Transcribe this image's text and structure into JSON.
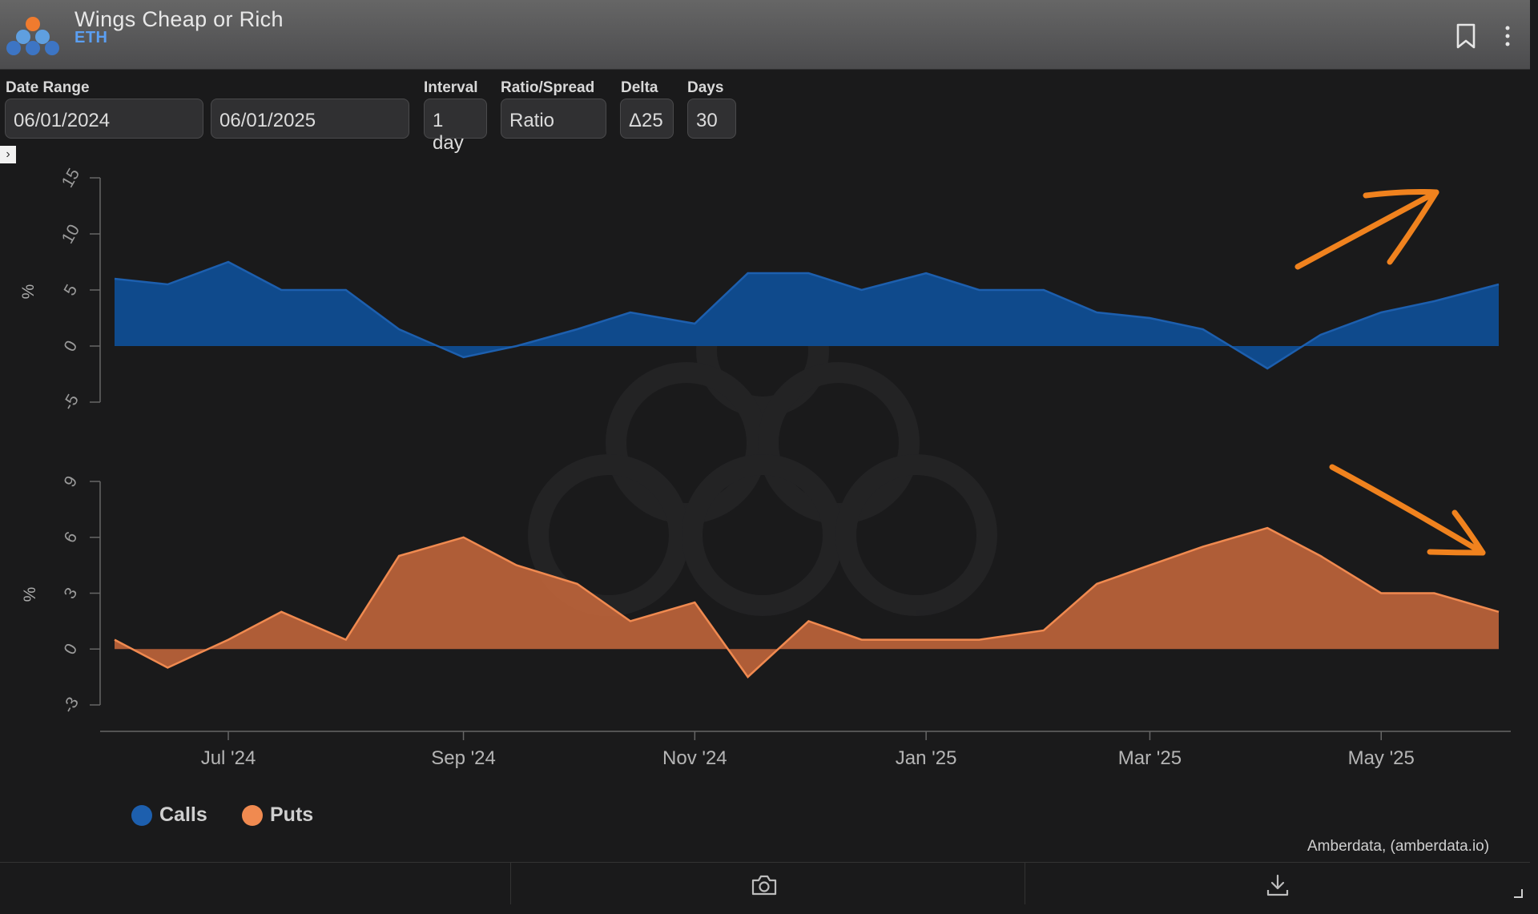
{
  "header": {
    "title": "Wings Cheap or Rich",
    "subtitle": "ETH"
  },
  "controls": {
    "date_range_label": "Date Range",
    "date_start": "06/01/2024",
    "date_end": "06/01/2025",
    "interval_label": "Interval",
    "interval_value": "1 day",
    "ratio_spread_label": "Ratio/Spread",
    "ratio_spread_value": "Ratio",
    "delta_label": "Delta",
    "delta_value": "Δ25",
    "days_label": "Days",
    "days_value": "30",
    "expand_icon": "chevron-right-icon"
  },
  "colors": {
    "calls": "#0f4a8c",
    "calls_line": "#1d5fae",
    "puts": "#c0653b",
    "puts_line": "#f08a50",
    "arrow": "#f0821e",
    "header_subtitle": "#5b9ff2"
  },
  "chart_data": {
    "type": "area",
    "x_range": [
      "2024-06-01",
      "2025-06-01"
    ],
    "x_tick_labels": [
      "Jul '24",
      "Sep '24",
      "Nov '24",
      "Jan '25",
      "Mar '25",
      "May '25"
    ],
    "panels": [
      {
        "series_name": "Calls",
        "ylabel": "%",
        "ylim": [
          -5,
          15
        ],
        "y_ticks": [
          "15",
          "10",
          "5",
          "0",
          "-5"
        ],
        "x": [
          "2024-06-01",
          "2024-06-15",
          "2024-07-01",
          "2024-07-15",
          "2024-08-01",
          "2024-08-15",
          "2024-09-01",
          "2024-09-15",
          "2024-10-01",
          "2024-10-15",
          "2024-11-01",
          "2024-11-15",
          "2024-12-01",
          "2024-12-15",
          "2025-01-01",
          "2025-01-15",
          "2025-02-01",
          "2025-02-15",
          "2025-03-01",
          "2025-03-15",
          "2025-04-01",
          "2025-04-15",
          "2025-05-01",
          "2025-05-15",
          "2025-06-01"
        ],
        "values": [
          6,
          5.5,
          7.5,
          5,
          5,
          1.5,
          -1,
          0,
          1.5,
          3,
          2,
          6.5,
          6.5,
          5,
          6.5,
          5,
          5,
          3,
          2.5,
          1.5,
          -2,
          1,
          3,
          4,
          5.5
        ]
      },
      {
        "series_name": "Puts",
        "ylabel": "%",
        "ylim": [
          -3,
          9
        ],
        "y_ticks": [
          "9",
          "6",
          "3",
          "0",
          "-3"
        ],
        "x": [
          "2024-06-01",
          "2024-06-15",
          "2024-07-01",
          "2024-07-15",
          "2024-08-01",
          "2024-08-15",
          "2024-09-01",
          "2024-09-15",
          "2024-10-01",
          "2024-10-15",
          "2024-11-01",
          "2024-11-15",
          "2024-12-01",
          "2024-12-15",
          "2025-01-01",
          "2025-01-15",
          "2025-02-01",
          "2025-02-15",
          "2025-03-01",
          "2025-03-15",
          "2025-04-01",
          "2025-04-15",
          "2025-05-01",
          "2025-05-15",
          "2025-06-01"
        ],
        "values": [
          0.5,
          -1,
          0.5,
          2,
          0.5,
          5,
          6,
          4.5,
          3.5,
          1.5,
          2.5,
          -1.5,
          1.5,
          0.5,
          0.5,
          0.5,
          1,
          3.5,
          4.5,
          5.5,
          6.5,
          5,
          3,
          3,
          2
        ]
      }
    ],
    "legend": [
      {
        "name": "Calls",
        "color": "#0f4a8c"
      },
      {
        "name": "Puts",
        "color": "#f08a50"
      }
    ],
    "legend_position": "bottom-left",
    "grid": false,
    "annotations": [
      {
        "type": "arrow",
        "direction": "up-right",
        "panel": "Calls",
        "color": "#f0821e"
      },
      {
        "type": "arrow",
        "direction": "down-right",
        "panel": "Puts",
        "color": "#f0821e"
      }
    ],
    "credit": "Amberdata, (amberdata.io)"
  },
  "footer": {
    "camera_icon": "camera-icon",
    "download_icon": "download-icon",
    "resize_icon": "resize-handle-icon"
  }
}
